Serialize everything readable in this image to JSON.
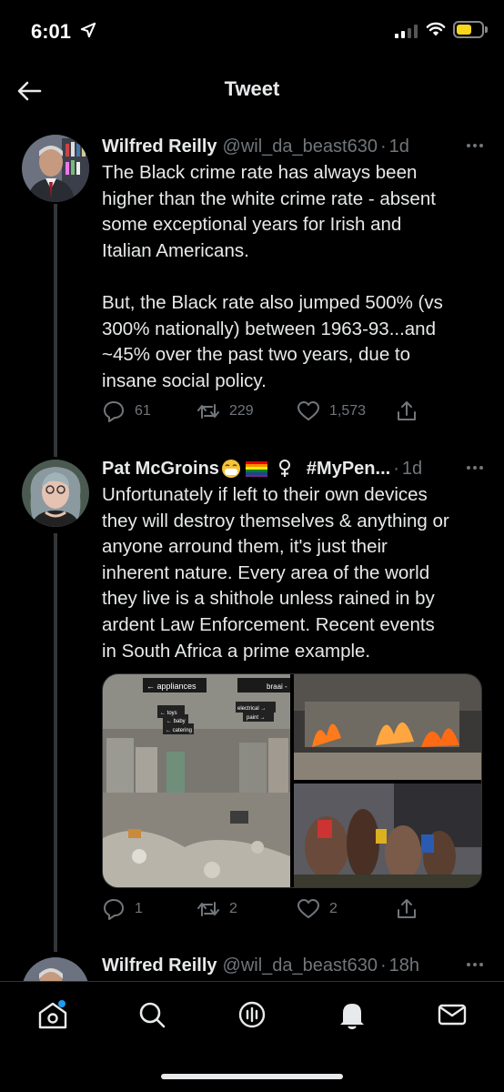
{
  "status_bar": {
    "time": "6:01",
    "battery_color": "#f9d71c"
  },
  "header": {
    "title": "Tweet",
    "back_icon": "arrow-left-icon"
  },
  "tweets": [
    {
      "name": "Wilfred Reilly",
      "handle": "@wil_da_beast630",
      "dot": "·",
      "time": "1d",
      "text_lines": [
        "The Black crime rate has always been",
        "higher than the white crime rate - absent",
        "some exceptional years for Irish and",
        "Italian Americans.",
        "",
        "But, the Black rate also jumped 500% (vs",
        "300% nationally) between 1963-93...and",
        "~45% over the past two years, due to",
        "insane social policy."
      ],
      "replies": "61",
      "retweets": "229",
      "likes": "1,573"
    },
    {
      "name": "Pat McGroins",
      "name_extra": "#MyPen...",
      "name_emojis": [
        "mask-face-emoji",
        "rainbow-flag-emoji",
        "female-sign"
      ],
      "handle": "",
      "dot": "·",
      "time": "1d",
      "text_lines": [
        "Unfortunately if left to their own devices",
        "they will destroy themselves & anything or",
        "anyone arround them, it's just their",
        "inherent nature. Every area of the world",
        "they live is a shithole unless rained in by",
        "ardent Law Enforcement. Recent events",
        "in South Africa a prime example."
      ],
      "media_signs": [
        "← appliances",
        "braai -",
        "← toys",
        "← baby",
        "← catering",
        "electrical →",
        "paint →"
      ],
      "replies": "1",
      "retweets": "2",
      "likes": "2"
    },
    {
      "name": "Wilfred Reilly",
      "handle": "@wil_da_beast630",
      "dot": "·",
      "time": "18h"
    }
  ],
  "tabbar": {
    "items": [
      "home-icon",
      "search-icon",
      "spaces-icon",
      "notifications-icon",
      "messages-icon"
    ],
    "accent": "#1d9bf0"
  }
}
